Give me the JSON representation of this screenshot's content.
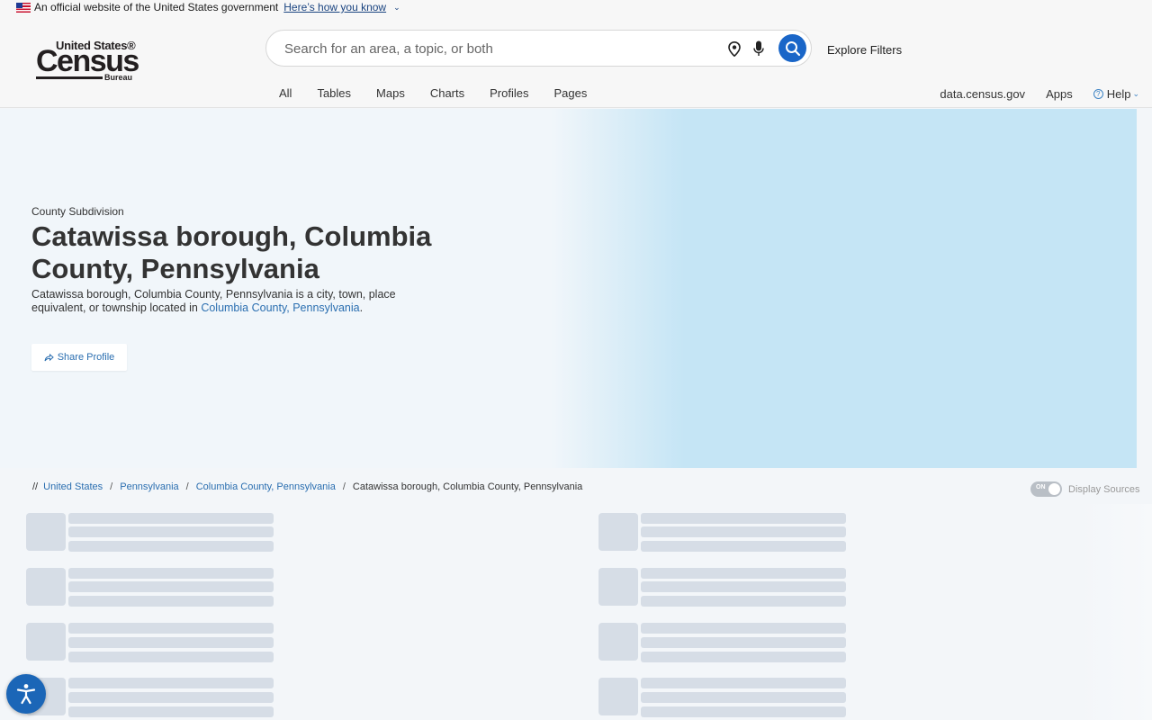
{
  "gov_banner": {
    "text": "An official website of the United States government",
    "link": "Here’s how you know"
  },
  "logo": {
    "line1": "United States®",
    "line2": "Census",
    "line3": "Bureau"
  },
  "search": {
    "placeholder": "Search for an area, a topic, or both"
  },
  "explore_filters": "Explore Filters",
  "nav": [
    "All",
    "Tables",
    "Maps",
    "Charts",
    "Profiles",
    "Pages"
  ],
  "utility": {
    "data_link": "data.census.gov",
    "apps": "Apps",
    "help": "Help"
  },
  "hero": {
    "type": "County Subdivision",
    "title": "Catawissa borough, Columbia County, Pennsylvania",
    "desc_prefix": "Catawissa borough, Columbia County, Pennsylvania is a city, town, place equivalent, or township located in ",
    "desc_link1": "Columbia County",
    "desc_comma": ", ",
    "desc_link2": "Pennsylvania",
    "desc_suffix": ".",
    "share": "Share Profile"
  },
  "breadcrumb": {
    "prefix": "//",
    "items": [
      "United States",
      "Pennsylvania",
      "Columbia County, Pennsylvania"
    ],
    "current": "Catawissa borough, Columbia County, Pennsylvania",
    "sep": "/"
  },
  "toggle": {
    "state": "ON",
    "label": "Display Sources"
  },
  "colors": {
    "accent": "#1a66c8",
    "link": "#2a6eb0",
    "hero_right": "#c5e5f5"
  }
}
